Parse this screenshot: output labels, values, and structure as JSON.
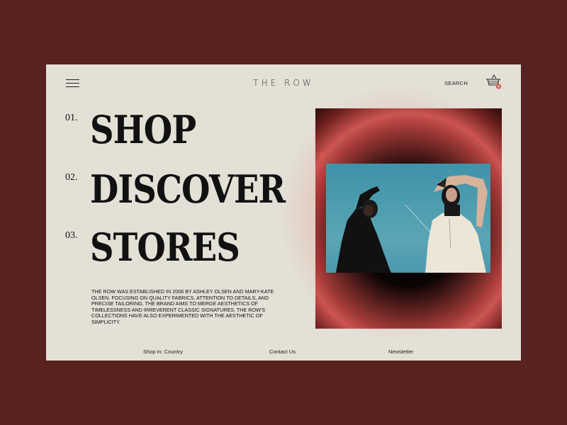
{
  "header": {
    "brand": "THE ROW",
    "search_label": "SEARCH",
    "menu_icon": "hamburger-icon",
    "cart_icon": "basket-icon"
  },
  "menu": [
    {
      "number": "01.",
      "label": "SHOP"
    },
    {
      "number": "02.",
      "label": "DISCOVER"
    },
    {
      "number": "03.",
      "label": "STORES"
    }
  ],
  "about_text": "THE ROW WAS ESTABLISHED IN 2006 BY ASHLEY OLSEN AND MARY-KATE OLSEN. FOCUSING ON QUALITY FABRICS, ATTENTION TO DETAILS, AND PRECISE TAILORING, THE BRAND AIMS TO MERGE AESTHETICS OF TIMELESSNESS AND IRREVERENT CLASSIC SIGNATURES. THE ROW'S COLLECTIONS HAVE ALSO EXPERIMENTED WITH THE AESTHETIC OF SIMPLICITY.",
  "footer": {
    "shop_in": "Shop in: Country",
    "contact": "Contact Us",
    "newsletter": "Newsletter"
  },
  "colors": {
    "background": "#572220",
    "page": "#e3e0d6",
    "accent": "#d9534f",
    "text": "#111111"
  }
}
